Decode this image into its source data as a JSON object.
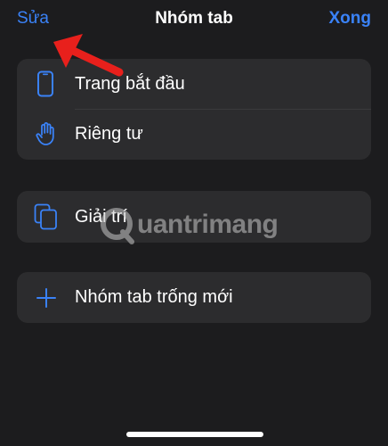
{
  "navbar": {
    "edit_label": "Sửa",
    "title": "Nhóm tab",
    "done_label": "Xong"
  },
  "groups": {
    "start_page": {
      "label": "Trang bắt đầu",
      "icon": "iphone-icon"
    },
    "private": {
      "label": "Riêng tư",
      "icon": "hand-icon"
    },
    "entertainment": {
      "label": "Giải trí",
      "icon": "tabs-copy-icon"
    },
    "new_empty": {
      "label": "Nhóm tab trống mới",
      "icon": "plus-icon"
    }
  },
  "watermark": {
    "text": "uantrimang"
  },
  "colors": {
    "background": "#1c1c1e",
    "card": "#2c2c2e",
    "accent": "#3a82f7",
    "annotation_arrow": "#e8201c"
  }
}
